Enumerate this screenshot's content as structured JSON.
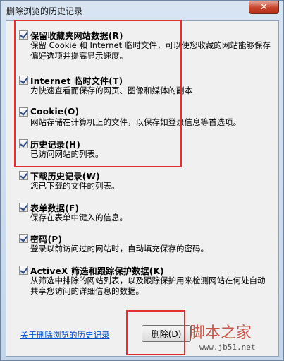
{
  "window": {
    "title": "删除浏览的历史记录",
    "close_label": "✕"
  },
  "options": [
    {
      "title": "保留收藏夹网站数据(R)",
      "desc": "保留 Cookie 和 Internet 临时文件，可以使您收藏的网站能够保存偏好选项并提高显示速度。",
      "checked": true
    },
    {
      "title": "Internet 临时文件(T)",
      "desc": "为快速查看而保存的网页、图像和媒体的副本",
      "checked": true
    },
    {
      "title": "Cookie(O)",
      "desc": "网站存储在计算机上的文件，以保存如登录信息等首选项。",
      "checked": true
    },
    {
      "title": "历史记录(H)",
      "desc": "已访问网站的列表。",
      "checked": true
    },
    {
      "title": "下载历史记录(W)",
      "desc": "您已下载的文件的列表。",
      "checked": true
    },
    {
      "title": "表单数据(F)",
      "desc": "保存在表单中键入的信息。",
      "checked": true
    },
    {
      "title": "密码(P)",
      "desc": "登录以前访问过的网站时，自动填充保存的密码。",
      "checked": true
    },
    {
      "title": "ActiveX 筛选和跟踪保护数据(K)",
      "desc": "从筛选中排除的网站列表，以及跟踪保护用来检测网站在何处自动共享您访问的详细信息的数据。",
      "checked": true
    }
  ],
  "footer": {
    "link": "关于删除浏览的历史记录",
    "delete_button": "删除(D)"
  },
  "watermark": {
    "text": "脚本之家",
    "url": "www.jb51.net"
  }
}
